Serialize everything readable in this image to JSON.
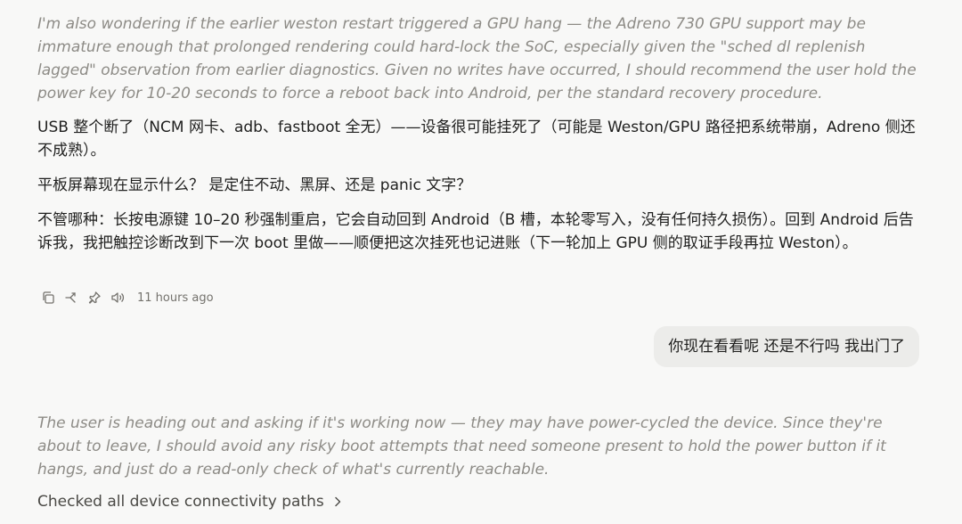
{
  "conversation": {
    "thinking_1": "I'm also wondering if the earlier weston restart triggered a GPU hang — the Adreno 730 GPU support may be immature enough that prolonged rendering could hard-lock the SoC, especially given the \"sched dl replenish lagged\" observation from earlier diagnostics. Given no writes have occurred, I should recommend the user hold the power key for 10-20 seconds to force a reboot back into Android, per the standard recovery procedure.",
    "assistant_paragraphs": [
      "USB 整个断了（NCM 网卡、adb、fastboot 全无）——设备很可能挂死了（可能是 Weston/GPU 路径把系统带崩，Adreno 侧还不成熟）。",
      "平板屏幕现在显示什么？ 是定住不动、黑屏、还是 panic 文字？",
      "不管哪种：长按电源键 10–20 秒强制重启，它会自动回到 Android（B 槽，本轮零写入，没有任何持久损伤）。回到 Android 后告诉我，我把触控诊断改到下一次 boot 里做——顺便把这次挂死也记进账（下一轮加上 GPU 侧的取证手段再拉 Weston）。"
    ],
    "message_actions": {
      "icons": [
        "copy-icon",
        "branch-icon",
        "pin-icon",
        "speaker-icon"
      ],
      "timestamp": "11 hours ago"
    },
    "user_message": "你现在看看呢 还是不行吗 我出门了",
    "thinking_2": "The user is heading out and asking if it's working now — they may have power-cycled the device. Since they're about to leave, I should avoid any risky boot attempts that need someone present to hold the power button if it hangs, and just do a read-only check of what's currently reachable.",
    "tool_summary": {
      "label": "Checked all device connectivity paths",
      "icon": "chevron-right-icon"
    }
  }
}
